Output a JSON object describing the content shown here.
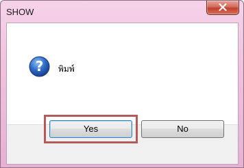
{
  "dialog": {
    "title": "SHOW",
    "message": "พิมพ์",
    "message_icon": "question-icon",
    "close_icon": "close-icon"
  },
  "buttons": {
    "yes_label": "Yes",
    "no_label": "No"
  },
  "colors": {
    "highlight_border": "#b55a5a",
    "close_button": "#c2402d",
    "question_icon_blue": "#2f6cc8"
  }
}
